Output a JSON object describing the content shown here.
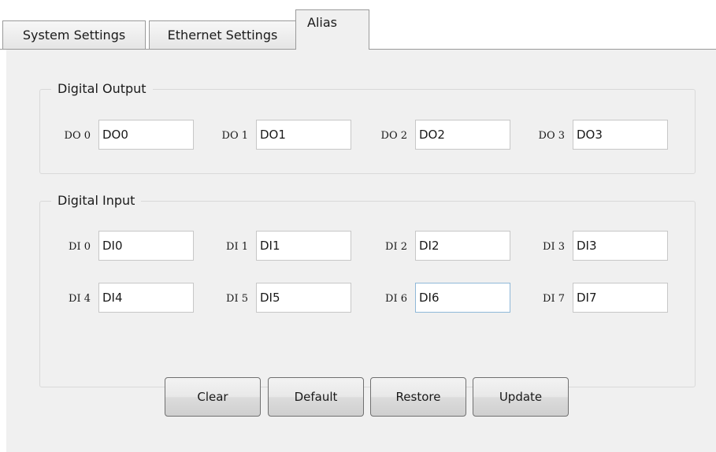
{
  "tabs": [
    {
      "label": "System Settings"
    },
    {
      "label": "Ethernet Settings"
    },
    {
      "label": "Alias"
    }
  ],
  "digital_output": {
    "title": "Digital Output",
    "fields": [
      {
        "label": "DO 0",
        "value": "DO0"
      },
      {
        "label": "DO 1",
        "value": "DO1"
      },
      {
        "label": "DO 2",
        "value": "DO2"
      },
      {
        "label": "DO 3",
        "value": "DO3"
      }
    ]
  },
  "digital_input": {
    "title": "Digital Input",
    "fields": [
      {
        "label": "DI 0",
        "value": "DI0"
      },
      {
        "label": "DI 1",
        "value": "DI1"
      },
      {
        "label": "DI 2",
        "value": "DI2"
      },
      {
        "label": "DI 3",
        "value": "DI3"
      },
      {
        "label": "DI 4",
        "value": "DI4"
      },
      {
        "label": "DI 5",
        "value": "DI5"
      },
      {
        "label": "DI 6",
        "value": "DI6"
      },
      {
        "label": "DI 7",
        "value": "DI7"
      }
    ]
  },
  "buttons": {
    "clear": "Clear",
    "default": "Default",
    "restore": "Restore",
    "update": "Update"
  }
}
